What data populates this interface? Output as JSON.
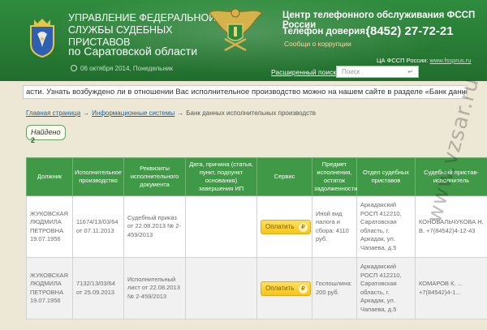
{
  "header": {
    "org_title": "Управление Федеральной службы судебных приставов",
    "org_region": "по Саратовской области",
    "date": "06 октября 2014, Понедельник",
    "call_center": "Центр телефонного обслуживания ФССП России",
    "hotline_label": "Телефон доверия:",
    "phone": "(8452) 27-72-21",
    "corruption_link": "Сообщи о коррупции",
    "ca_prefix": "ЦА ФССП России: ",
    "ca_link": "www.fssprus.ru",
    "advanced_search": "Расширенный поиск",
    "search_placeholder": "Поиск",
    "search_go": "↵"
  },
  "ticker": "асти. Узнать возбуждено ли в отношении Вас исполнительное производство можно на нашем сайте в разделе «Банк данных исполнительных производств»",
  "breadcrumb": {
    "home": "Главная страница",
    "sep1": "→",
    "systems": "Информационные системы",
    "sep2": "→",
    "current": "Банк данных исполнительных производств"
  },
  "found": {
    "label": "Найдено ",
    "count": "2"
  },
  "table": {
    "headers": [
      "Должник",
      "Исполнительное производство",
      "Реквизиты исполнительного документа",
      "Дата, причина (статья, пункт, подпункт основания) завершения ИП",
      "Сервис",
      "Предмет исполнения, остаток задолженности",
      "Отдел судебных приставов",
      "Судебный пристав-исполнитель"
    ],
    "pay_label": "Оплатить",
    "pay_icon": "₽",
    "rows": [
      {
        "debtor": "ЖУКОВСКАЯ ЛЮДМИЛА ПЕТРОВНА 19.07.1956",
        "proceeding": "11674/13/03/64 от 07.11.2013",
        "document": "Судебный приказ от 22.08.2013 № 2-459/2013",
        "end": "",
        "subject": "Иной вид налога и сбора: 4110 руб.",
        "department": "Аркадакский РОСП 412210, Саратовская область, г. Аркадак, ул. Чапаева, д.5",
        "bailiff": "КОНОВАЛЬЧУКОВА Н. В. +7(84542)4-12-43"
      },
      {
        "debtor": "ЖУКОВСКАЯ ЛЮДМИЛА ПЕТРОВНА 19.07.1956",
        "proceeding": "7132/13/03/64 от 25.09.2013",
        "document": "Исполнительный лист от 22.08.2013 № 2-459/2013",
        "end": "",
        "subject": "Госпошлина: 200 руб.",
        "department": "Аркадакский РОСП 412210, Саратовская область, г. Аркадак, ул. Чапаева, д.5",
        "bailiff": "КОМАРОВ К. ... +7(84542)4-1..."
      }
    ]
  },
  "watermark": "www.vzsar.ru",
  "colors": {
    "header_green": "#2f8c3d",
    "table_header": "#3f9946",
    "pay_button": "#f7c51b",
    "corruption": "#ffd7a2"
  }
}
